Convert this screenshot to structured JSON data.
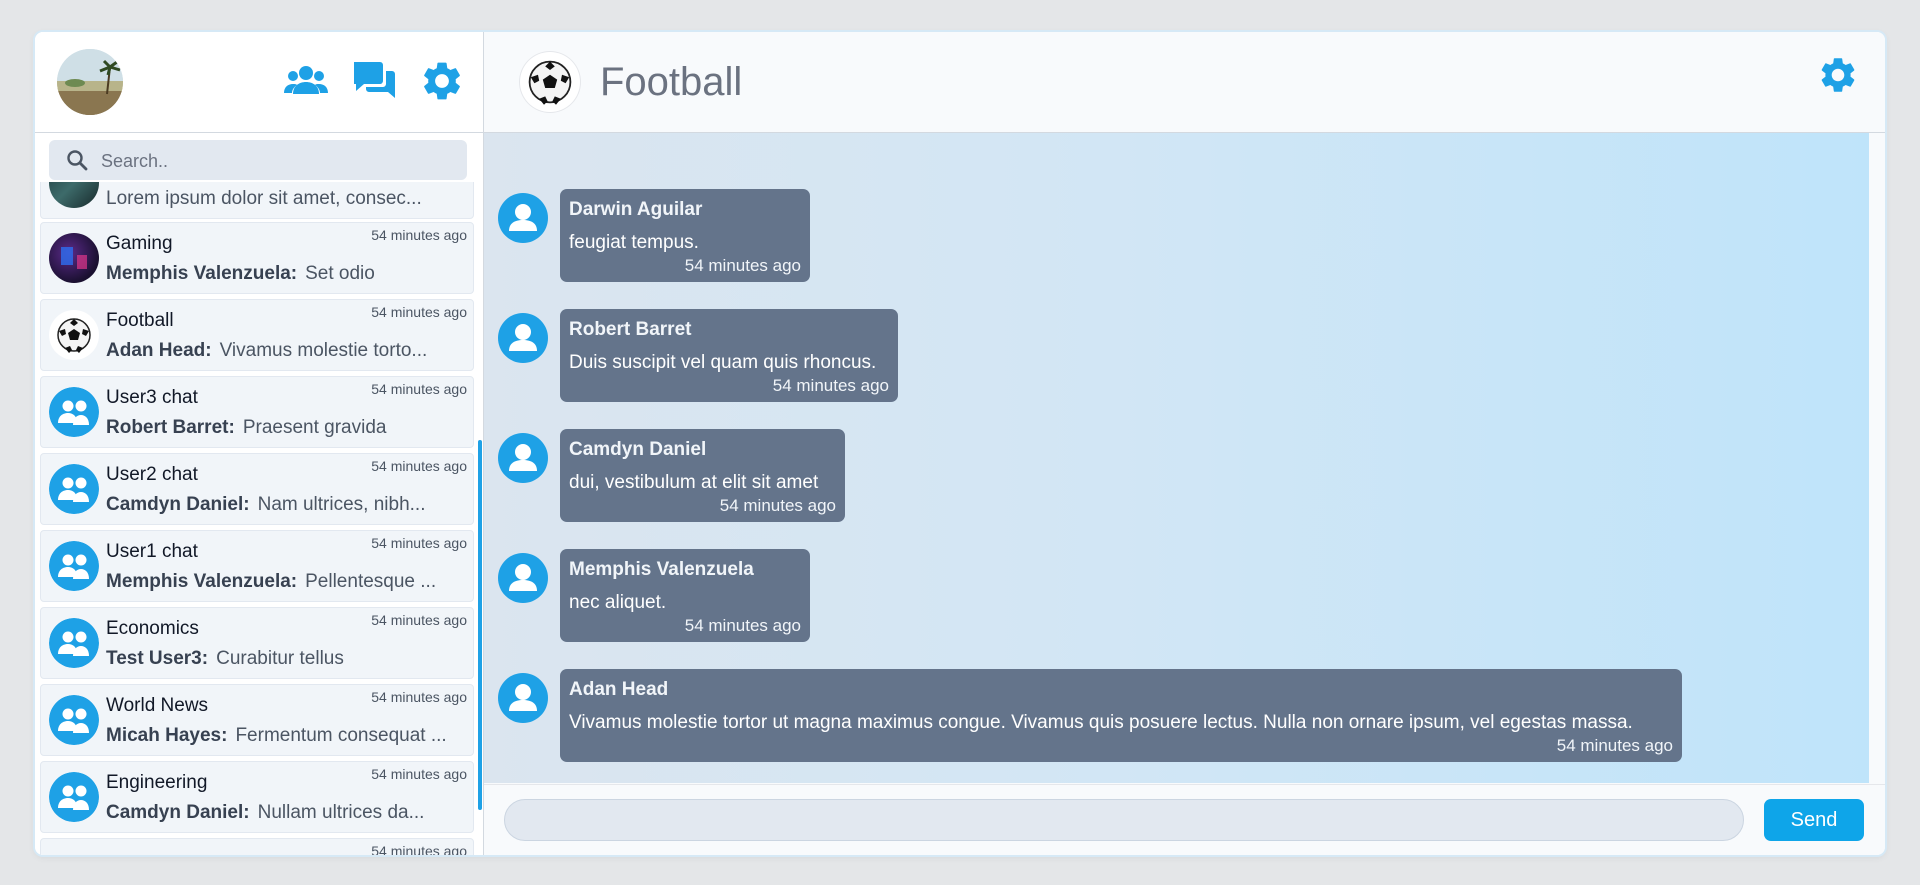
{
  "sidebar": {
    "search_placeholder": "Search..",
    "chats": [
      {
        "name": "",
        "time": "",
        "sender": "",
        "preview": "Lorem ipsum dolor sit amet, consec...",
        "avatar": "photo-ocean"
      },
      {
        "name": "Gaming",
        "time": "54 minutes ago",
        "sender": "Memphis Valenzuela:",
        "preview": "Set odio",
        "avatar": "photo-gaming"
      },
      {
        "name": "Football",
        "time": "54 minutes ago",
        "sender": "Adan Head:",
        "preview": "Vivamus molestie torto...",
        "avatar": "soccer-ball"
      },
      {
        "name": "User3 chat",
        "time": "54 minutes ago",
        "sender": "Robert Barret:",
        "preview": "Praesent gravida",
        "avatar": "group-icon"
      },
      {
        "name": "User2 chat",
        "time": "54 minutes ago",
        "sender": "Camdyn Daniel:",
        "preview": "Nam ultrices, nibh...",
        "avatar": "group-icon"
      },
      {
        "name": "User1 chat",
        "time": "54 minutes ago",
        "sender": "Memphis Valenzuela:",
        "preview": "Pellentesque ...",
        "avatar": "group-icon"
      },
      {
        "name": "Economics",
        "time": "54 minutes ago",
        "sender": "Test User3:",
        "preview": "Curabitur tellus",
        "avatar": "group-icon"
      },
      {
        "name": "World News",
        "time": "54 minutes ago",
        "sender": "Micah Hayes:",
        "preview": "Fermentum consequat ...",
        "avatar": "group-icon"
      },
      {
        "name": "Engineering",
        "time": "54 minutes ago",
        "sender": "Camdyn Daniel:",
        "preview": "Nullam ultrices da...",
        "avatar": "group-icon"
      },
      {
        "name": "",
        "time": "54 minutes ago",
        "sender": "",
        "preview": "",
        "avatar": ""
      }
    ]
  },
  "main": {
    "title": "Football",
    "messages": [
      {
        "sender": "Darwin Aguilar",
        "text": "feugiat tempus.",
        "time": "54 minutes ago"
      },
      {
        "sender": "Robert Barret",
        "text": "Duis suscipit vel quam quis rhoncus.",
        "time": "54 minutes ago"
      },
      {
        "sender": "Camdyn Daniel",
        "text": "dui, vestibulum at elit sit amet",
        "time": "54 minutes ago"
      },
      {
        "sender": "Memphis Valenzuela",
        "text": "nec aliquet.",
        "time": "54 minutes ago"
      },
      {
        "sender": "Adan Head",
        "text": "Vivamus molestie tortor ut magna maximus congue. Vivamus quis posuere lectus. Nulla non ornare ipsum, vel egestas massa.",
        "time": "54 minutes ago"
      }
    ],
    "input_placeholder": "",
    "send_label": "Send"
  },
  "colors": {
    "accent": "#1ea1e6",
    "bubble": "#64748b",
    "send": "#0ea5e9"
  },
  "icons": [
    "users-icon",
    "chat-icon",
    "gear-icon",
    "search-icon",
    "user-avatar-icon",
    "soccer-ball-icon"
  ]
}
